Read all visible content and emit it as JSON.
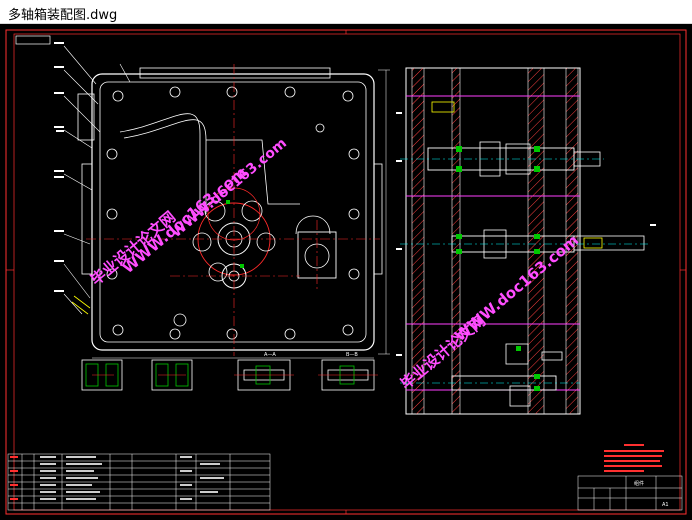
{
  "window": {
    "title": "多轴箱装配图.dwg"
  },
  "drawing": {
    "background": "#000000",
    "colors": {
      "frame": "#ff3030",
      "outline": "#ffffff",
      "center": "#ff2a2a",
      "green": "#00c800",
      "cyan": "#00ffff",
      "yellow": "#ffff00",
      "magenta": "#ff40ff",
      "hatch": "#ff4040"
    },
    "watermarks": [
      {
        "text": "毕业设计论文网"
      },
      {
        "text": "WWW.doc163.com"
      },
      {
        "text": "毕业设计论文网"
      },
      {
        "text": "WWW.doc163.com"
      },
      {
        "text": "毕业设计论文网"
      },
      {
        "text": "WWW.doc163.com"
      }
    ],
    "section_labels": {
      "aa": "A—A",
      "bb": "B—B"
    },
    "title_block": {
      "label_main": "组件",
      "label_code": "A1"
    }
  }
}
